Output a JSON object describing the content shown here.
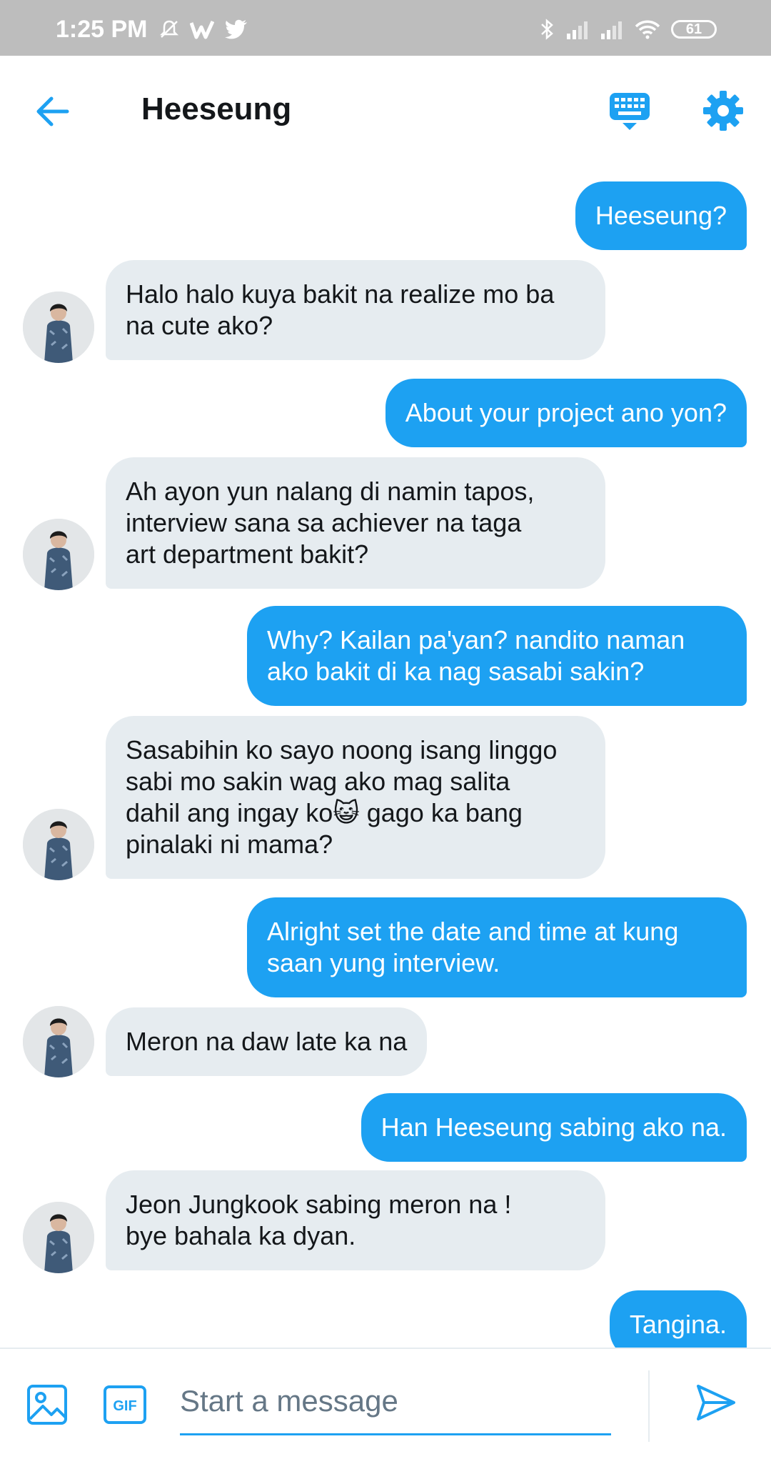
{
  "status_bar": {
    "time": "1:25 PM",
    "battery": "61",
    "left_icons": [
      "mute-bell-icon",
      "wattpad-icon",
      "twitter-icon"
    ],
    "right_icons": [
      "bluetooth-icon",
      "signal-icon",
      "signal-icon",
      "wifi-icon",
      "battery-icon"
    ]
  },
  "header": {
    "title": "Heeseung",
    "icons": [
      "back-arrow-icon",
      "keyboard-icon",
      "gear-icon"
    ]
  },
  "colors": {
    "accent": "#1da1f2",
    "received_bubble": "#e6ecf0",
    "text": "#14171a"
  },
  "messages": [
    {
      "from": "me",
      "text": "Heeseung?"
    },
    {
      "from": "them",
      "text": "Halo halo kuya bakit na realize mo ba\nna cute ako?"
    },
    {
      "from": "me",
      "text": "About your project ano yon?"
    },
    {
      "from": "them",
      "text": "Ah ayon yun nalang di namin tapos,\ninterview sana sa achiever na  taga\nart department bakit?"
    },
    {
      "from": "me",
      "text": "Why? Kailan pa'yan? nandito naman\nako bakit di ka nag sasabi sakin?"
    },
    {
      "from": "them",
      "text": "Sasabihin ko sayo noong isang linggo\nsabi mo sakin wag ako mag salita\ndahil ang ingay ko😺 gago ka bang\npinalaki ni mama?"
    },
    {
      "from": "me",
      "text": "Alright set the date and time at kung\nsaan yung interview."
    },
    {
      "from": "them",
      "text": "Meron na daw late ka na"
    },
    {
      "from": "me",
      "text": "Han Heeseung sabing ako na."
    },
    {
      "from": "them",
      "text": "Jeon Jungkook sabing meron na !\nbye bahala ka dyan."
    },
    {
      "from": "me",
      "text": "Tangina."
    }
  ],
  "composer": {
    "placeholder": "Start a message",
    "gif_label": "GIF",
    "icons": [
      "image-icon",
      "gif-icon",
      "send-icon"
    ]
  }
}
